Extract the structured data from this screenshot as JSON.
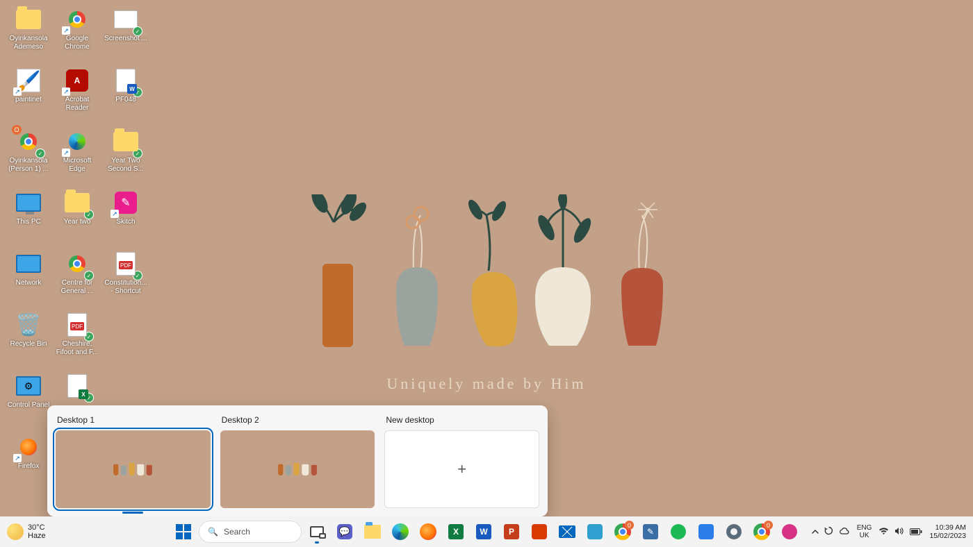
{
  "wallpaper": {
    "caption": "Uniquely made by Him"
  },
  "desktop_icons": [
    {
      "label": "Oyinkansola Ademeso",
      "type": "folder"
    },
    {
      "label": "Google Chrome",
      "type": "chrome",
      "shortcut": true
    },
    {
      "label": "Screenshot ...",
      "type": "image",
      "sync": true
    },
    {
      "label": "paintinet",
      "type": "app-paint",
      "shortcut": true
    },
    {
      "label": "Acrobat Reader",
      "type": "acrobat",
      "shortcut": true
    },
    {
      "label": "PF048",
      "type": "doc-word",
      "sync": true
    },
    {
      "label": "Oyinkansola (Person 1) ...",
      "type": "chrome",
      "sync": true,
      "badge": "O"
    },
    {
      "label": "Microsoft Edge",
      "type": "edge",
      "shortcut": true
    },
    {
      "label": "Year Two Second S...",
      "type": "folder",
      "sync": true
    },
    {
      "label": "This PC",
      "type": "thispc"
    },
    {
      "label": "Year two",
      "type": "folder",
      "sync": true
    },
    {
      "label": "Skitch",
      "type": "skitch",
      "shortcut": true
    },
    {
      "label": "Network",
      "type": "network"
    },
    {
      "label": "Centre for General ...",
      "type": "chrome",
      "sync": true
    },
    {
      "label": "Constitution... - Shortcut",
      "type": "pdf",
      "sync": true
    },
    {
      "label": "Recycle Bin",
      "type": "recycle"
    },
    {
      "label": "Cheshire, Fifoot and F...",
      "type": "pdf",
      "sync": true
    },
    {
      "label": "",
      "type": "empty"
    },
    {
      "label": "Control Panel",
      "type": "controlpanel"
    },
    {
      "label": "",
      "type": "excel-file",
      "sync": true,
      "noLabel": true
    },
    {
      "label": "",
      "type": "empty"
    },
    {
      "label": "Firefox",
      "type": "firefox",
      "shortcut": true
    }
  ],
  "taskview": {
    "items": [
      {
        "title": "Desktop 1",
        "active": true
      },
      {
        "title": "Desktop 2",
        "active": false
      },
      {
        "title": "New desktop",
        "new": true
      }
    ]
  },
  "taskbar": {
    "weather": {
      "temp": "30°C",
      "cond": "Haze"
    },
    "search_placeholder": "Search",
    "center_apps": [
      {
        "name": "start",
        "tip": "Start"
      },
      {
        "name": "search",
        "tip": "Search"
      },
      {
        "name": "taskview",
        "tip": "Task View",
        "active": true
      },
      {
        "name": "chat",
        "tip": "Chat"
      },
      {
        "name": "explorer",
        "tip": "File Explorer"
      },
      {
        "name": "edge",
        "tip": "Microsoft Edge"
      },
      {
        "name": "firefox",
        "tip": "Firefox"
      },
      {
        "name": "excel",
        "tip": "Excel"
      },
      {
        "name": "word",
        "tip": "Word"
      },
      {
        "name": "powerpoint",
        "tip": "PowerPoint"
      },
      {
        "name": "office",
        "tip": "Office"
      },
      {
        "name": "mail",
        "tip": "Mail"
      },
      {
        "name": "app-blue",
        "tip": "App"
      },
      {
        "name": "chrome",
        "tip": "Google Chrome",
        "badge": "0"
      },
      {
        "name": "app-editor",
        "tip": "App"
      },
      {
        "name": "spotify",
        "tip": "Spotify"
      },
      {
        "name": "app-tool",
        "tip": "App"
      },
      {
        "name": "settings",
        "tip": "Settings"
      },
      {
        "name": "chrome2",
        "tip": "Google Chrome",
        "badge": "0"
      },
      {
        "name": "app-pink",
        "tip": "App"
      }
    ],
    "tray_icons": [
      "chevron-up",
      "sync",
      "cloud",
      "wifi",
      "volume",
      "battery"
    ],
    "language": {
      "top": "ENG",
      "bottom": "UK"
    },
    "clock": {
      "time": "10:39 AM",
      "date": "15/02/2023"
    }
  }
}
